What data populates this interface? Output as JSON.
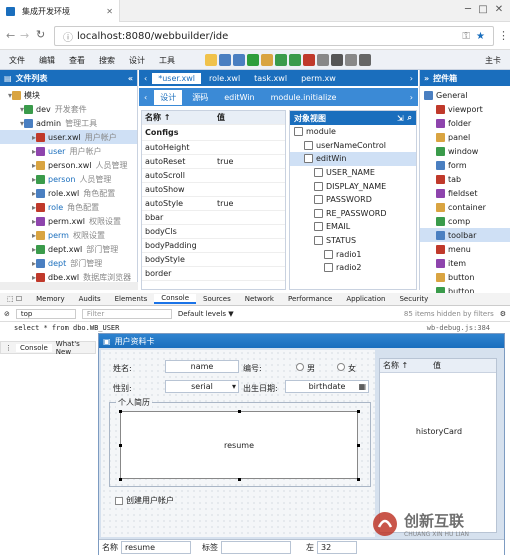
{
  "browser": {
    "tab_title": "集成开发环境",
    "url": "localhost:8080/webbuilder/ide"
  },
  "menu": [
    "文件",
    "编辑",
    "查看",
    "搜索",
    "设计",
    "工具",
    "主卡"
  ],
  "left_panel": {
    "title": "文件列表",
    "tree": [
      {
        "name": "模块",
        "note": "",
        "level": 0
      },
      {
        "name": "dev",
        "note": "开发套件",
        "level": 1
      },
      {
        "name": "admin",
        "note": "管理工具",
        "level": 1
      },
      {
        "name": "user.xwl",
        "note": "用户帐户",
        "level": 2,
        "selected": true
      },
      {
        "name": "user",
        "note": "用户帐户",
        "level": 2
      },
      {
        "name": "person.xwl",
        "note": "人员管理",
        "level": 2
      },
      {
        "name": "person",
        "note": "人员管理",
        "level": 2
      },
      {
        "name": "role.xwl",
        "note": "角色配置",
        "level": 2
      },
      {
        "name": "role",
        "note": "角色配置",
        "level": 2
      },
      {
        "name": "perm.xwl",
        "note": "权限设置",
        "level": 2
      },
      {
        "name": "perm",
        "note": "权限设置",
        "level": 2
      },
      {
        "name": "dept.xwl",
        "note": "部门管理",
        "level": 2
      },
      {
        "name": "dept",
        "note": "部门管理",
        "level": 2
      },
      {
        "name": "dbe.xwl",
        "note": "数据库浏览器",
        "level": 2
      }
    ]
  },
  "editor_tabs": [
    "*user.xwl",
    "role.xwl",
    "task.xwl",
    "perm.xw"
  ],
  "sub_tabs": [
    "设计",
    "源码",
    "editWin",
    "module.initialize"
  ],
  "props": {
    "col_name": "名称 ↑",
    "col_value": "值",
    "group": "Configs",
    "rows": [
      [
        "autoHeight",
        ""
      ],
      [
        "autoReset",
        "true"
      ],
      [
        "autoScroll",
        ""
      ],
      [
        "autoShow",
        ""
      ],
      [
        "autoStyle",
        "true"
      ],
      [
        "bbar",
        ""
      ],
      [
        "bodyCls",
        ""
      ],
      [
        "bodyPadding",
        ""
      ],
      [
        "bodyStyle",
        ""
      ],
      [
        "border",
        ""
      ]
    ]
  },
  "objview": {
    "title": "对象视图",
    "items": [
      {
        "name": "module",
        "level": 0
      },
      {
        "name": "userNameControl",
        "level": 1
      },
      {
        "name": "editWin",
        "level": 1,
        "selected": true
      },
      {
        "name": "USER_NAME",
        "level": 2
      },
      {
        "name": "DISPLAY_NAME",
        "level": 2
      },
      {
        "name": "PASSWORD",
        "level": 2
      },
      {
        "name": "RE_PASSWORD",
        "level": 2
      },
      {
        "name": "EMAIL",
        "level": 2
      },
      {
        "name": "STATUS",
        "level": 2
      },
      {
        "name": "radio1",
        "level": 3
      },
      {
        "name": "radio2",
        "level": 3
      }
    ]
  },
  "controls": {
    "title": "控件箱",
    "items": [
      "General",
      "viewport",
      "folder",
      "panel",
      "window",
      "form",
      "tab",
      "fieldset",
      "container",
      "comp",
      "toolbar",
      "menu",
      "item",
      "button",
      "button"
    ]
  },
  "devtools": {
    "tabs": [
      "Memory",
      "Audits",
      "Elements",
      "Console",
      "Sources",
      "Network",
      "Performance",
      "Application",
      "Security"
    ],
    "context": "top",
    "filter_placeholder": "Filter",
    "levels": "Default levels ▼",
    "hidden": "85 items hidden by filters",
    "log": "select * from dbo.WB_USER",
    "log_src": "wb-debug.js:384",
    "bottom_tabs": [
      "Console",
      "What's New"
    ]
  },
  "form": {
    "title": "用户资料卡",
    "name_label": "姓名:",
    "name_value": "name",
    "no_label": "编号:",
    "male": "男",
    "female": "女",
    "gender_label": "性别:",
    "gender_value": "serial",
    "birth_label": "出生日期:",
    "birth_value": "birthdate",
    "resume_legend": "个人简历",
    "resume_value": "resume",
    "create_account": "创建用户帐户",
    "grid_name": "名称 ↑",
    "grid_value": "值",
    "history": "historyCard",
    "status_name_label": "名称",
    "status_name_value": "resume",
    "status_tag_label": "标签",
    "status_left_label": "左",
    "status_left_value": "32"
  },
  "watermark": {
    "cn": "创新互联",
    "en": "CHUANG XIN HU LIAN"
  }
}
